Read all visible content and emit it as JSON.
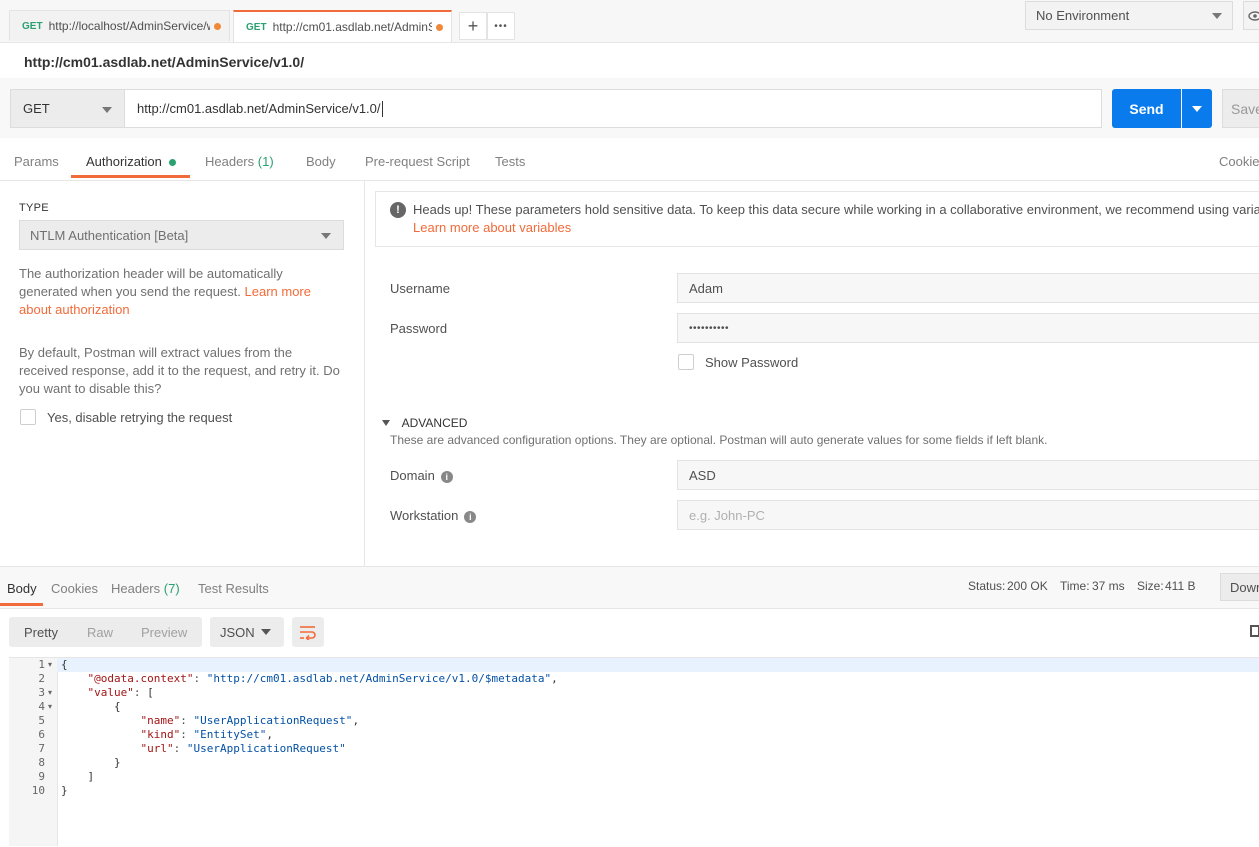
{
  "tabs": [
    {
      "method": "GET",
      "url": "http://localhost/AdminService/w",
      "unsaved": true,
      "active": false
    },
    {
      "method": "GET",
      "url": "http://cm01.asdlab.net/AdminSe",
      "unsaved": true,
      "active": true
    }
  ],
  "tabbar": {
    "new_tab_icon": "+",
    "more_icon": "•••"
  },
  "environment": {
    "selected": "No Environment"
  },
  "request": {
    "title": "http://cm01.asdlab.net/AdminService/v1.0/",
    "method": "GET",
    "url": "http://cm01.asdlab.net/AdminService/v1.0/",
    "send_label": "Send",
    "save_label": "Save"
  },
  "request_tabs": [
    {
      "label": "Params"
    },
    {
      "label": "Authorization",
      "active": true,
      "indicator": "green-dot"
    },
    {
      "label": "Headers",
      "count": "(1)"
    },
    {
      "label": "Body"
    },
    {
      "label": "Pre-request Script"
    },
    {
      "label": "Tests"
    }
  ],
  "cookies_link": "Cookies",
  "auth": {
    "type_label": "TYPE",
    "type_value": "NTLM Authentication [Beta]",
    "desc_text": "The authorization header will be automatically generated when you send the request. ",
    "desc_link": "Learn more about authorization",
    "retry_text": "By default, Postman will extract values from the received response, add it to the request, and retry it. Do you want to disable this?",
    "retry_checkbox_label": "Yes, disable retrying the request",
    "alert_text": "Heads up! These parameters hold sensitive data. To keep this data secure while working in a collaborative environment, we recommend using variables.",
    "alert_link": "Learn more about variables",
    "username_label": "Username",
    "username_value": "Adam",
    "password_label": "Password",
    "password_value": "••••••••••",
    "show_password_label": "Show Password",
    "advanced_label": "ADVANCED",
    "advanced_desc": "These are advanced configuration options. They are optional. Postman will auto generate values for some fields if left blank.",
    "domain_label": "Domain",
    "domain_value": "ASD",
    "workstation_label": "Workstation",
    "workstation_placeholder": "e.g. John-PC"
  },
  "response_tabs": [
    {
      "label": "Body",
      "active": true
    },
    {
      "label": "Cookies"
    },
    {
      "label": "Headers",
      "count": "(7)"
    },
    {
      "label": "Test Results"
    }
  ],
  "status": {
    "status_label": "Status:",
    "status_value": "200 OK",
    "time_label": "Time:",
    "time_value": "37 ms",
    "size_label": "Size:",
    "size_value": "411 B",
    "download_label": "Down"
  },
  "view_modes": [
    {
      "label": "Pretty",
      "active": true
    },
    {
      "label": "Raw"
    },
    {
      "label": "Preview"
    }
  ],
  "format": "JSON",
  "code_lines": [
    {
      "n": "1",
      "fold": true,
      "text": "{"
    },
    {
      "n": "2",
      "key": "\"@odata.context\"",
      "value": "\"http://cm01.asdlab.net/AdminService/v1.0/$metadata\"",
      "suffix": ",",
      "indent": "    "
    },
    {
      "n": "3",
      "fold": true,
      "key": "\"value\"",
      "suffix": "[",
      "indent": "    "
    },
    {
      "n": "4",
      "fold": true,
      "text": "{",
      "indent": "        "
    },
    {
      "n": "5",
      "key": "\"name\"",
      "value": "\"UserApplicationRequest\"",
      "suffix": ",",
      "indent": "            "
    },
    {
      "n": "6",
      "key": "\"kind\"",
      "value": "\"EntitySet\"",
      "suffix": ",",
      "indent": "            "
    },
    {
      "n": "7",
      "key": "\"url\"",
      "value": "\"UserApplicationRequest\"",
      "suffix": "",
      "indent": "            "
    },
    {
      "n": "8",
      "text": "}",
      "indent": "        "
    },
    {
      "n": "9",
      "text": "]",
      "indent": "    "
    },
    {
      "n": "10",
      "text": "}"
    }
  ],
  "colors": {
    "accent": "#f26b3a",
    "send": "#097bed",
    "success": "#2aa170"
  }
}
